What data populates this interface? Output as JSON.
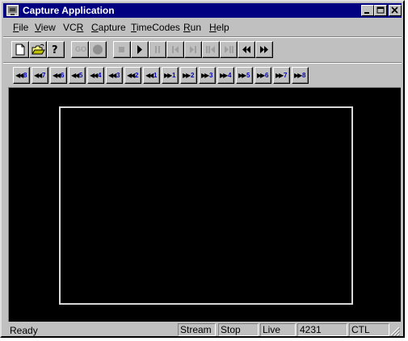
{
  "window": {
    "title": "Capture Application"
  },
  "menu": [
    {
      "pre": "",
      "u": "F",
      "post": "ile"
    },
    {
      "pre": "",
      "u": "V",
      "post": "iew"
    },
    {
      "pre": "VC",
      "u": "R",
      "post": ""
    },
    {
      "pre": "",
      "u": "C",
      "post": "apture"
    },
    {
      "pre": "",
      "u": "T",
      "post": "imeCodes"
    },
    {
      "pre": "",
      "u": "R",
      "post": "un"
    },
    {
      "pre": "",
      "u": "H",
      "post": "elp"
    }
  ],
  "toolbar": {
    "go_label": "GO"
  },
  "speed_buttons": {
    "rewind": [
      "8",
      "7",
      "6",
      "5",
      "4",
      "3",
      "2",
      "1"
    ],
    "forward": [
      "1",
      "2",
      "3",
      "4",
      "5",
      "6",
      "7",
      "8"
    ]
  },
  "status": {
    "ready": "Ready",
    "mode": "Stream",
    "state": "Stop",
    "source": "Live",
    "frame": "4231",
    "control": "CTL"
  },
  "colors": {
    "titlebar": "#000080",
    "chrome": "#c0c0c0",
    "video": "#000000",
    "speed_number": "#0000c0"
  }
}
